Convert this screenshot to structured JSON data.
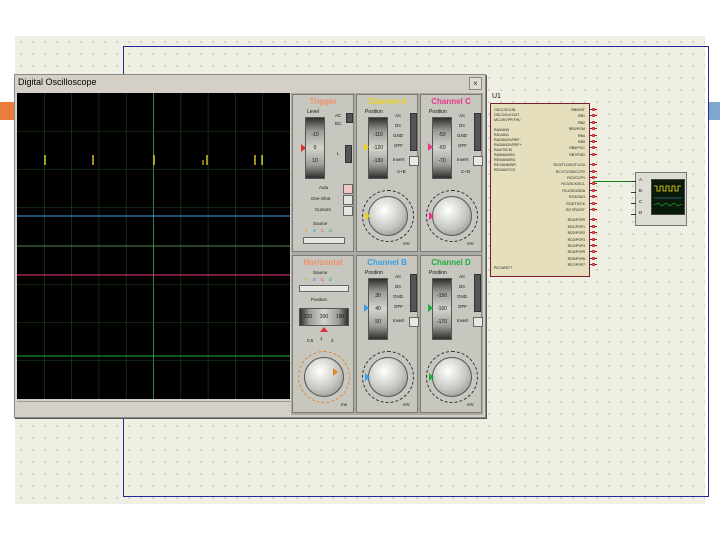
{
  "oscilloscope": {
    "title": "Digital Oscilloscope",
    "close_glyph": "×",
    "trigger": {
      "title": "Trigger",
      "level_label": "Level",
      "ticks": [
        "-10",
        "0",
        "10"
      ],
      "coupling": [
        "AC",
        "DC"
      ],
      "edge_label": "L",
      "modes": [
        "Auto",
        "One-Shot",
        "Cursors"
      ],
      "source_label": "Source",
      "sources": [
        "A",
        "B",
        "C",
        "D"
      ]
    },
    "horizontal": {
      "title": "Horizontal",
      "source_label": "Source",
      "sources": [
        "A",
        "B",
        "C",
        "D"
      ],
      "position_label": "Position",
      "position_values": [
        "210",
        "200",
        "190"
      ],
      "knob_scale": [
        "0.5",
        "1",
        "2"
      ],
      "unit": "ms"
    },
    "channels": [
      {
        "title": "Channel A",
        "color": "#f4e01a",
        "position_label": "Position",
        "values": [
          "-110",
          "-120",
          "-130"
        ],
        "coupling": [
          "AC",
          "DC",
          "GND",
          "OFF"
        ],
        "invert": "Invert",
        "ab": "A+B",
        "unit": "mV"
      },
      {
        "title": "Channel B",
        "color": "#3aa0e8",
        "position_label": "Position",
        "values": [
          "30",
          "40",
          "50"
        ],
        "coupling": [
          "AC",
          "DC",
          "GND",
          "OFF"
        ],
        "invert": "Invert",
        "ab": "",
        "unit": "mV"
      },
      {
        "title": "Channel C",
        "color": "#e8358a",
        "position_label": "Position",
        "values": [
          "-50",
          "-60",
          "-70"
        ],
        "coupling": [
          "AC",
          "DC",
          "GND",
          "OFF"
        ],
        "invert": "Invert",
        "ab": "C+D",
        "unit": "mV"
      },
      {
        "title": "Channel D",
        "color": "#1fae3a",
        "position_label": "Position",
        "values": [
          "-150",
          "-160",
          "-170"
        ],
        "coupling": [
          "AC",
          "DC",
          "GND",
          "OFF"
        ],
        "invert": "Invert",
        "ab": "",
        "unit": "mV"
      }
    ],
    "colors": {
      "trigger": "#f0906a",
      "horizontal": "#f0906a",
      "trace_a": "#f4e01a",
      "trace_b": "#3aa0e8",
      "trace_c": "#e8358a",
      "trace_d": "#1fae3a"
    }
  },
  "schematic": {
    "component_label": "U1",
    "left_pins": [
      "OSC1/CLKIN",
      "OSC2/CLKOUT",
      "MCLR/VPP/THV",
      "RA0/AN0",
      "RA1/AN1",
      "RA2/AN2/VREF-",
      "RA3/AN3/VREF+",
      "RA4/T0CKI",
      "RA5/AN4/SS",
      "RE0/AN5/RD",
      "RE1/AN6/WR",
      "RE2/AN7/CS"
    ],
    "right_pins": [
      "RB0/INT",
      "RB1",
      "RB2",
      "RB3/PGM",
      "RB4",
      "RB5",
      "RB6/PGC",
      "RB7/PGD",
      "RC0/T1OSO/T1CKI",
      "RC1/T1OSI/CCP2",
      "RC2/CCP1",
      "RC3/SCK/SCL",
      "RC4/SDI/SDA",
      "RC5/SDO",
      "RC6/TX/CK",
      "RC7/RX/DT",
      "RD0/PSP0",
      "RD1/PSP1",
      "RD2/PSP2",
      "RD3/PSP3",
      "RD4/PSP4",
      "RD5/PSP5",
      "RD6/PSP6",
      "RD7/PSP7"
    ],
    "part_number": "PIC16F877",
    "scope_ports": [
      "A",
      "B",
      "C",
      "D"
    ]
  }
}
